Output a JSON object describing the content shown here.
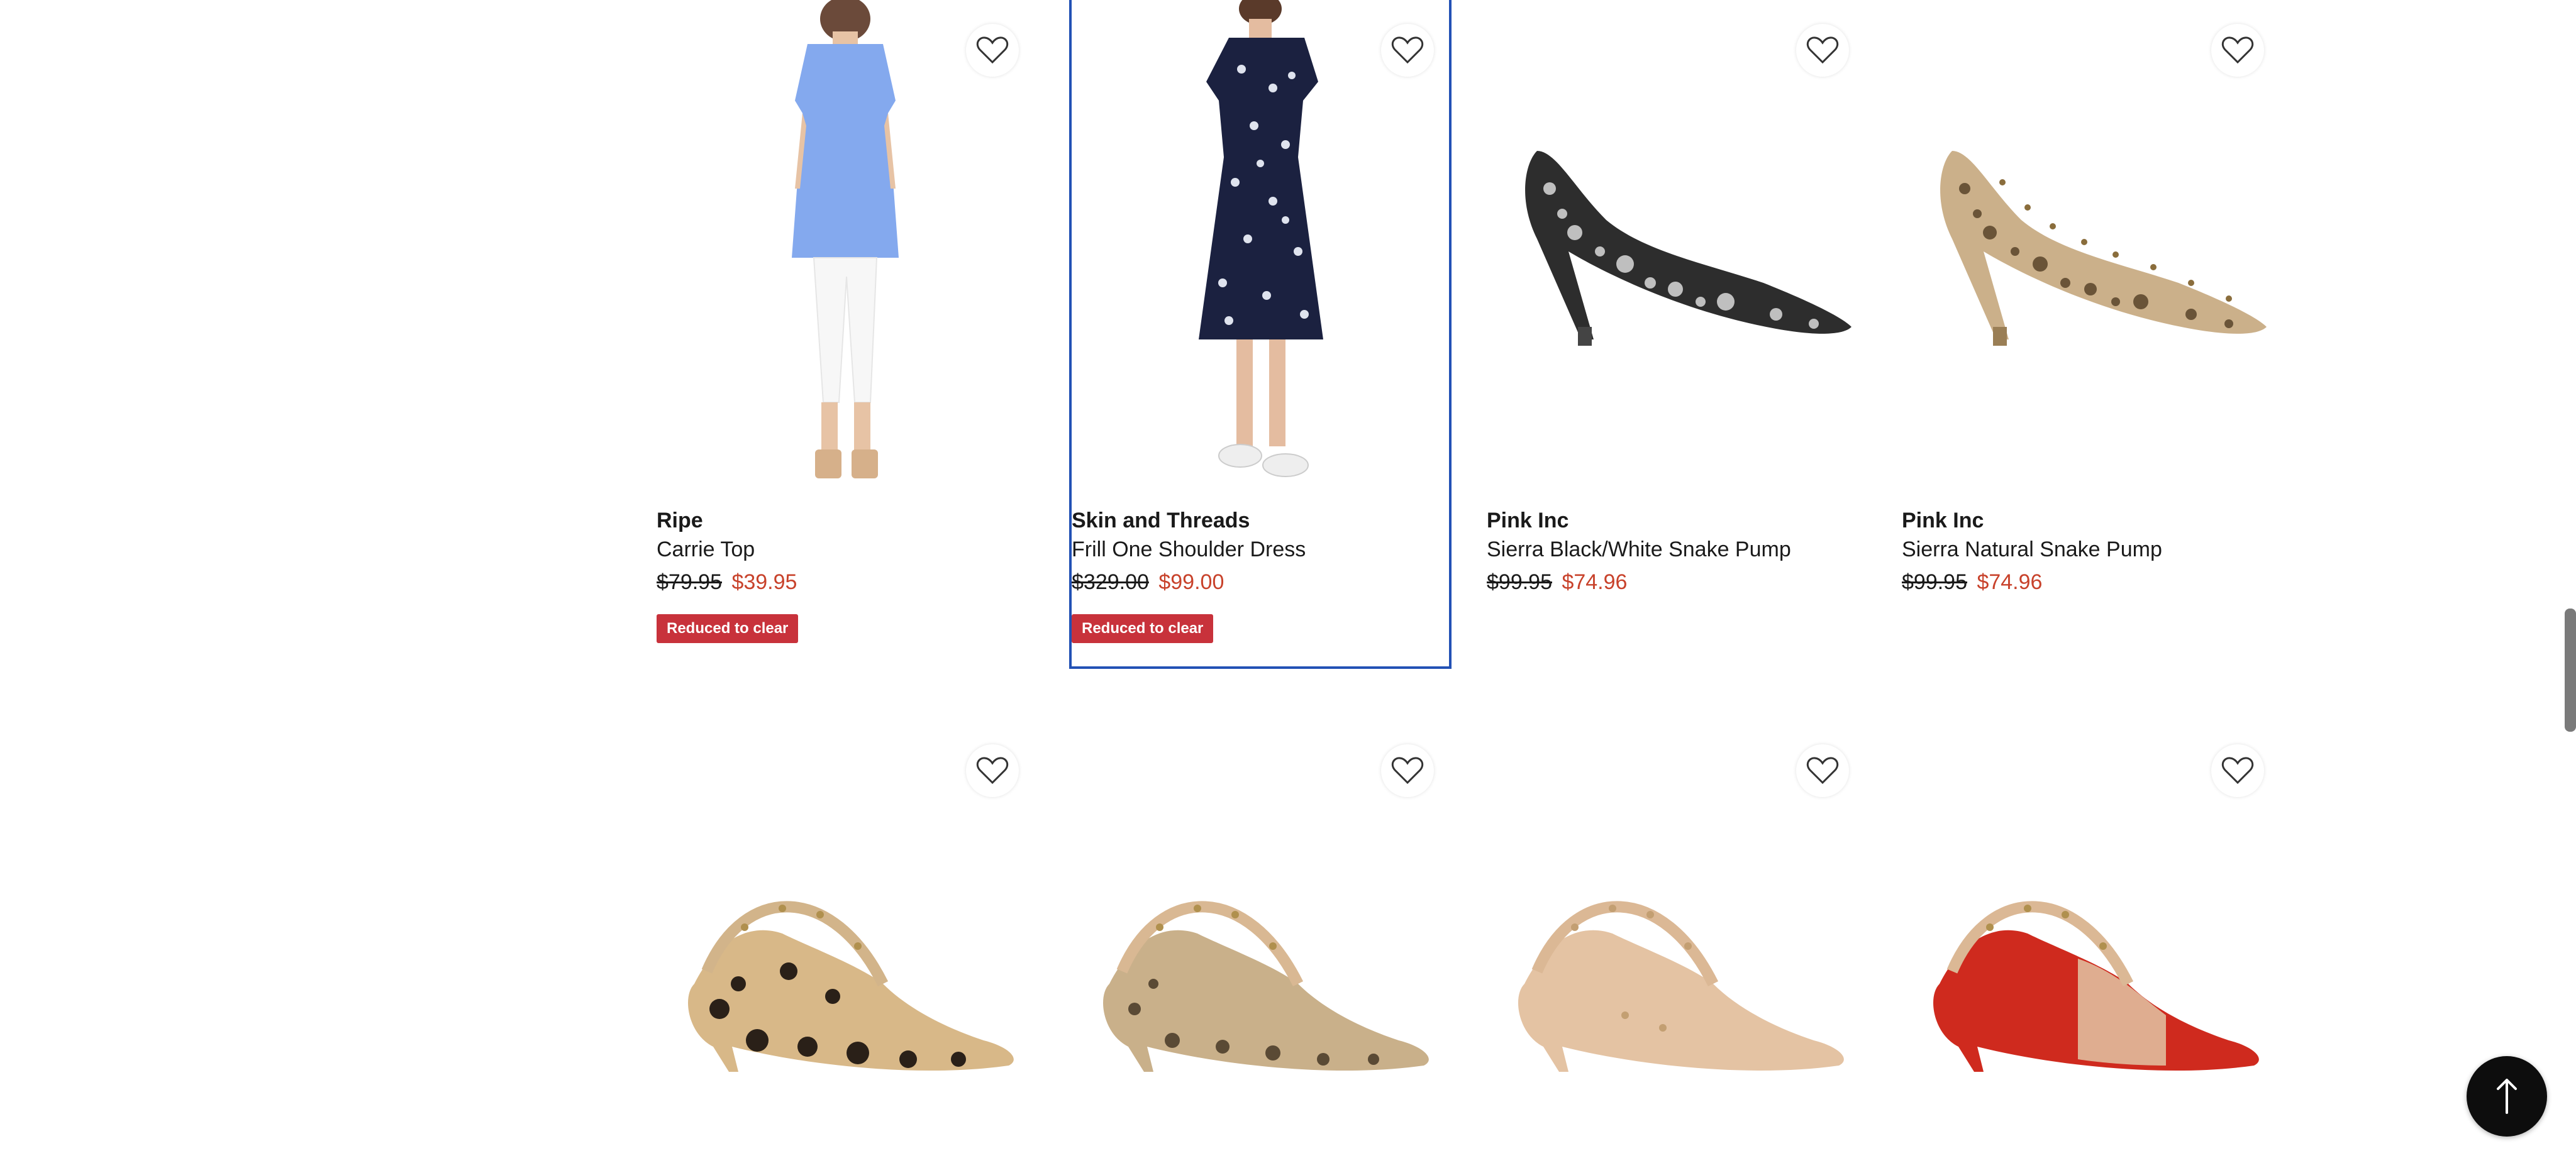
{
  "products": [
    {
      "brand": "Ripe",
      "name": "Carrie Top",
      "was_price": "$79.95",
      "now_price": "$39.95",
      "badge": "Reduced to clear",
      "image": "blue-top-icon"
    },
    {
      "brand": "Skin and Threads",
      "name": "Frill One Shoulder Dress",
      "was_price": "$329.00",
      "now_price": "$99.00",
      "badge": "Reduced to clear",
      "image": "floral-dress-icon"
    },
    {
      "brand": "Pink Inc",
      "name": "Sierra Black/White Snake Pump",
      "was_price": "$99.95",
      "now_price": "$74.96",
      "image": "black-snake-pump-icon"
    },
    {
      "brand": "Pink Inc",
      "name": "Sierra Natural Snake Pump",
      "was_price": "$99.95",
      "now_price": "$74.96",
      "image": "natural-snake-pump-icon"
    },
    {
      "image": "leopard-slingback-icon"
    },
    {
      "image": "snake-slingback-icon"
    },
    {
      "image": "nude-slingback-icon"
    },
    {
      "image": "red-slingback-icon"
    }
  ],
  "colors": {
    "price_sale": "#c8422b",
    "badge": "#c8323b",
    "focus": "#2251b5"
  },
  "icons": {
    "favorite": "heart-icon",
    "back_to_top": "arrow-up-icon"
  }
}
